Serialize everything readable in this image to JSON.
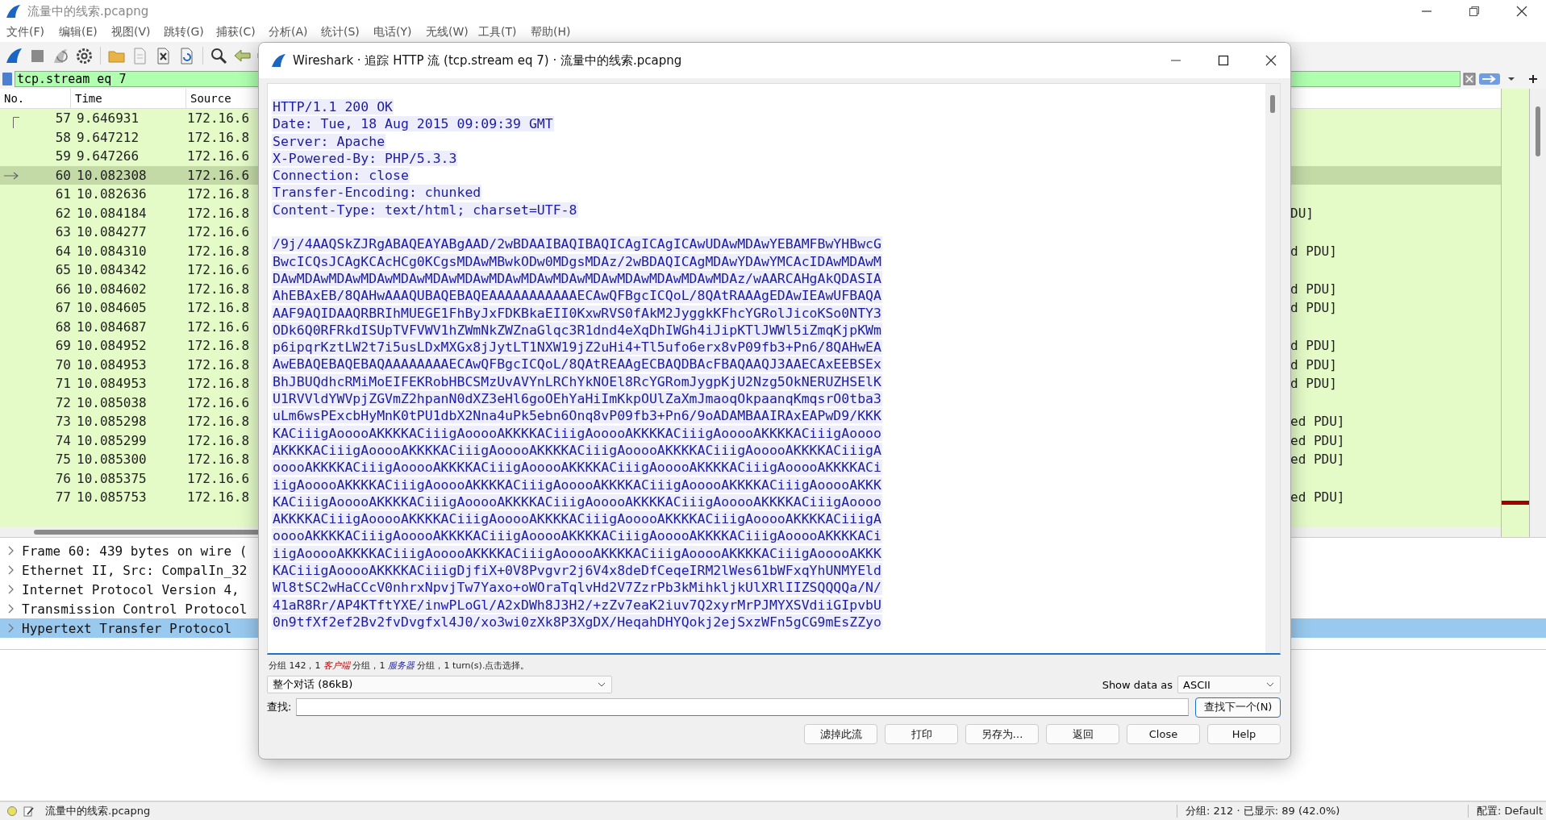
{
  "window": {
    "title": "流量中的线索.pcapng"
  },
  "menu": [
    "文件(F)",
    "编辑(E)",
    "视图(V)",
    "跳转(G)",
    "捕获(C)",
    "分析(A)",
    "统计(S)",
    "电话(Y)",
    "无线(W)",
    "工具(T)",
    "帮助(H)"
  ],
  "display_filter": {
    "value": "tcp.stream eq 7"
  },
  "packet_list": {
    "columns": [
      "No.",
      "Time",
      "Source"
    ],
    "rows": [
      {
        "no": "57",
        "time": "9.646931",
        "source": "172.16.6",
        "selected": false
      },
      {
        "no": "58",
        "time": "9.647212",
        "source": "172.16.8",
        "selected": false
      },
      {
        "no": "59",
        "time": "9.647266",
        "source": "172.16.6",
        "selected": false
      },
      {
        "no": "60",
        "time": "10.082308",
        "source": "172.16.6",
        "selected": true
      },
      {
        "no": "61",
        "time": "10.082636",
        "source": "172.16.8",
        "selected": false
      },
      {
        "no": "62",
        "time": "10.084184",
        "source": "172.16.8",
        "info": "DU]",
        "selected": false
      },
      {
        "no": "63",
        "time": "10.084277",
        "source": "172.16.6",
        "selected": false
      },
      {
        "no": "64",
        "time": "10.084310",
        "source": "172.16.8",
        "info": "d PDU]",
        "selected": false
      },
      {
        "no": "65",
        "time": "10.084342",
        "source": "172.16.6",
        "selected": false
      },
      {
        "no": "66",
        "time": "10.084602",
        "source": "172.16.8",
        "info": "d PDU]",
        "selected": false
      },
      {
        "no": "67",
        "time": "10.084605",
        "source": "172.16.8",
        "info": "d PDU]",
        "selected": false
      },
      {
        "no": "68",
        "time": "10.084687",
        "source": "172.16.6",
        "selected": false
      },
      {
        "no": "69",
        "time": "10.084952",
        "source": "172.16.8",
        "info": "d PDU]",
        "selected": false
      },
      {
        "no": "70",
        "time": "10.084953",
        "source": "172.16.8",
        "info": "d PDU]",
        "selected": false
      },
      {
        "no": "71",
        "time": "10.084953",
        "source": "172.16.8",
        "info": "d PDU]",
        "selected": false
      },
      {
        "no": "72",
        "time": "10.085038",
        "source": "172.16.6",
        "selected": false
      },
      {
        "no": "73",
        "time": "10.085298",
        "source": "172.16.8",
        "info": "ed PDU]",
        "selected": false
      },
      {
        "no": "74",
        "time": "10.085299",
        "source": "172.16.8",
        "info": "ed PDU]",
        "selected": false
      },
      {
        "no": "75",
        "time": "10.085300",
        "source": "172.16.8",
        "info": "ed PDU]",
        "selected": false
      },
      {
        "no": "76",
        "time": "10.085375",
        "source": "172.16.6",
        "selected": false
      },
      {
        "no": "77",
        "time": "10.085753",
        "source": "172.16.8",
        "info": "ed PDU]",
        "selected": false
      }
    ]
  },
  "packet_details": [
    {
      "text": "Frame 60: 439 bytes on wire (",
      "expanded": false,
      "selected": false
    },
    {
      "text": "Ethernet II, Src: CompalIn_32",
      "expanded": false,
      "selected": false
    },
    {
      "text": "Internet Protocol Version 4,",
      "expanded": false,
      "selected": false
    },
    {
      "text": "Transmission Control Protocol",
      "expanded": false,
      "selected": false
    },
    {
      "text": "Hypertext Transfer Protocol",
      "expanded": false,
      "selected": true
    }
  ],
  "stream_dialog": {
    "title": "Wireshark · 追踪 HTTP 流 (tcp.stream eq 7) · 流量中的线索.pcapng",
    "blocks": [
      {
        "lines": [
          "HTTP/1.1 200 OK",
          "Date: Tue, 18 Aug 2015 09:09:39 GMT",
          "Server: Apache",
          "X-Powered-By: PHP/5.3.3",
          "Connection: close",
          "Transfer-Encoding: chunked",
          "Content-Type: text/html; charset=UTF-8"
        ]
      },
      {
        "lines": [
          "/9j/4AAQSkZJRgABAQEAYABgAAD/2wBDAAIBAQIBAQICAgICAgICAwUDAwMDAwYEBAMFBwYHBwcG",
          "BwcICQsJCAgKCAcHCg0KCgsMDAwMBwkODw0MDgsMDAz/2wBDAQICAgMDAwYDAwYMCAcIDAwMDAwM",
          "DAwMDAwMDAwMDAwMDAwMDAwMDAwMDAwMDAwMDAwMDAwMDAwMDAwMDAwMDAz/wAARCAHgAkQDASIA",
          "AhEBAxEB/8QAHwAAAQUBAQEBAQEAAAAAAAAAAAECAwQFBgcICQoL/8QAtRAAAgEDAwIEAwUFBAQA",
          "AAF9AQIDAAQRBRIhMUEGE1FhByJxFDKBkaEII0KxwRVS0fAkM2JyggkKFhcYGRolJicoKSo0NTY3",
          "ODk6Q0RFRkdISUpTVFVWV1hZWmNkZWZnaGlqc3R1dnd4eXqDhIWGh4iJipKTlJWWl5iZmqKjpKWm",
          "p6ipqrKztLW2t7i5usLDxMXGx8jJytLT1NXW19jZ2uHi4+Tl5ufo6erx8vP09fb3+Pn6/8QAHwEA",
          "AwEBAQEBAQEBAQAAAAAAAAECAwQFBgcICQoL/8QAtREAAgECBAQDBAcFBAQAAQJ3AAECAxEEBSEx",
          "BhJBUQdhcRMiMoEIFEKRobHBCSMzUvAVYnLRChYkNOEl8RcYGRomJygpKjU2Nzg5OkNERUZHSElK",
          "U1RVVldYWVpjZGVmZ2hpanN0dXZ3eHl6goOEhYaHiImKkpOUlZaXmJmaoqOkpaanqKmqsrO0tba3",
          "uLm6wsPExcbHyMnK0tPU1dbX2Nna4uPk5ebn6Onq8vP09fb3+Pn6/9oADAMBAAIRAxEAPwD9/KKK",
          "KACiiigAooooAKKKKACiiigAooooAKKKKACiiigAooooAKKKKACiiigAooooAKKKKACiiigAoooo",
          "AKKKKACiiigAooooAKKKKACiiigAooooAKKKKACiiigAooooAKKKKACiiigAooooAKKKKACiiigA",
          "ooooAKKKKACiiigAooooAKKKKACiiigAooooAKKKKACiiigAooooAKKKKACiiigAooooAKKKKACi",
          "iigAooooAKKKKACiiigAooooAKKKKACiiigAooooAKKKKACiiigAooooAKKKKACiiigAooooAKKK",
          "KACiiigAooooAKKKKACiiigAooooAKKKKACiiigAooooAKKKKACiiigAooooAKKKKACiiigAoooo",
          "AKKKKACiiigAooooAKKKKACiiigAooooAKKKKACiiigAooooAKKKKACiiigAooooAKKKKACiiigA",
          "ooooAKKKKACiiigAooooAKKKKACiiigAooooAKKKKACiiigAooooAKKKKACiiigAooooAKKKKACi",
          "iigAooooAKKKKACiiigAooooAKKKKACiiigAooooAKKKKACiiigAooooAKKKKACiiigAooooAKKK",
          "KACiiigAooooAKKKKACiiigDjfiX+0V8Pvgvr2j6V4x8deDfCeqeIRM2lWes61bWFxqYhUNMYEld",
          "Wl8tSC2wHaCCcV0nhrxNpvjTw7Yaxo+oWOraTqlvHd2V7ZzrPb3kMihkljkUlXRlIIZSQQQQa/N/",
          "41aR8Rr/AP4KTftYXE/inwPLoGl/A2xDWh8J3H2/+zZv7eaK2iuv7Q2xyrMrPJMYXSVdiiGIpvbU",
          "0n9tfXf2ef2Bv2fvDvgfxl4J0/xo3wi0zXk8P3XgDX/HeqahDHYQokj2ejSxzWFn5gCG9mEsZZyo"
        ]
      }
    ],
    "summary": [
      {
        "kind": "plain",
        "text": "分组 142，1 "
      },
      {
        "kind": "client",
        "text": "客户端"
      },
      {
        "kind": "plain",
        "text": " 分组，1 "
      },
      {
        "kind": "server",
        "text": "服务器"
      },
      {
        "kind": "plain",
        "text": " 分组，1 turn(s).点击选择。"
      }
    ],
    "conversation": "整个对话 (86kB)",
    "show_data_label": "Show data as",
    "show_data_as": "ASCII",
    "find_label": "查找:",
    "find_next": "查找下一个(N)",
    "buttons": [
      "滤掉此流",
      "打印",
      "另存为…",
      "返回",
      "Close",
      "Help"
    ]
  },
  "status_bar": {
    "file": "流量中的线索.pcapng",
    "packets": "分组: 212 · 已显示: 89 (42.0%)",
    "profile": "配置: Default"
  }
}
